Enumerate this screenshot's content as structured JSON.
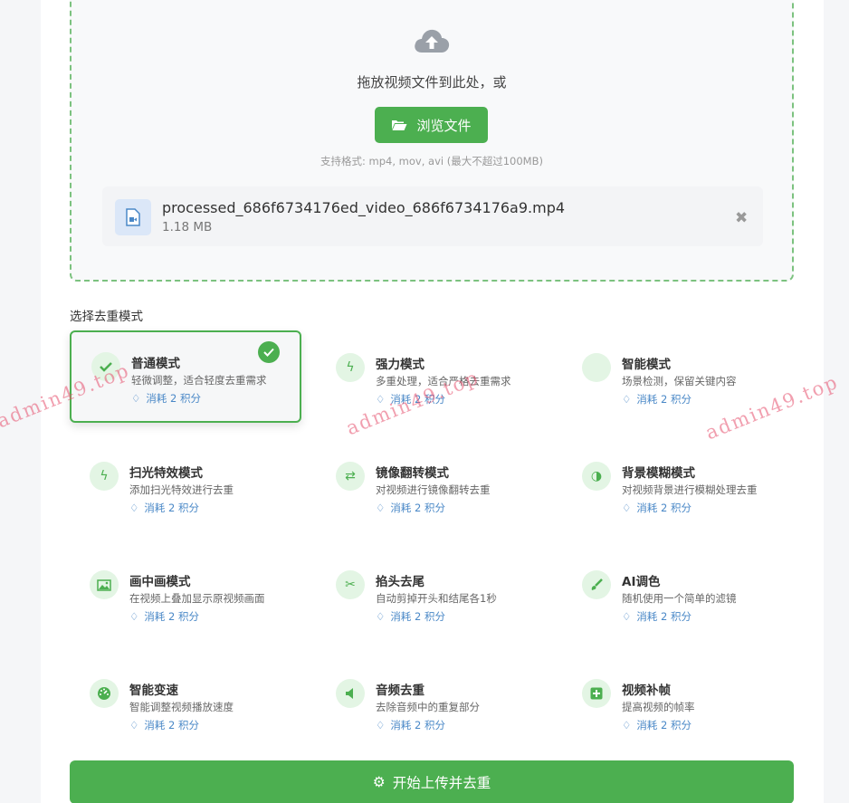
{
  "upload": {
    "drop_text": "拖放视频文件到此处，或",
    "browse_label": "浏览文件",
    "formats": "支持格式: mp4, mov, avi (最大不超过100MB)"
  },
  "file": {
    "name": "processed_686f6734176ed_video_686f6734176a9.mp4",
    "size": "1.18 MB"
  },
  "modes_title": "选择去重模式",
  "modes": [
    {
      "name": "普通模式",
      "desc": "轻微调整，适合轻度去重需求",
      "cost": "消耗 2 积分",
      "icon": "check-icon",
      "selected": true
    },
    {
      "name": "强力模式",
      "desc": "多重处理，适合严格去重需求",
      "cost": "消耗 2 积分",
      "icon": "bolt-icon"
    },
    {
      "name": "智能模式",
      "desc": "场景检测，保留关键内容",
      "cost": "消耗 2 积分",
      "icon": "blank-icon"
    },
    {
      "name": "扫光特效模式",
      "desc": "添加扫光特效进行去重",
      "cost": "消耗 2 积分",
      "icon": "bolt-icon"
    },
    {
      "name": "镜像翻转模式",
      "desc": "对视频进行镜像翻转去重",
      "cost": "消耗 2 积分",
      "icon": "swap-icon"
    },
    {
      "name": "背景模糊模式",
      "desc": "对视频背景进行模糊处理去重",
      "cost": "消耗 2 积分",
      "icon": "half-circle-icon"
    },
    {
      "name": "画中画模式",
      "desc": "在视频上叠加显示原视频画面",
      "cost": "消耗 2 积分",
      "icon": "image-icon"
    },
    {
      "name": "掐头去尾",
      "desc": "自动剪掉开头和结尾各1秒",
      "cost": "消耗 2 积分",
      "icon": "scissors-icon"
    },
    {
      "name": "AI调色",
      "desc": "随机使用一个简单的滤镜",
      "cost": "消耗 2 积分",
      "icon": "brush-icon"
    },
    {
      "name": "智能变速",
      "desc": "智能调整视频播放速度",
      "cost": "消耗 2 积分",
      "icon": "gauge-icon"
    },
    {
      "name": "音频去重",
      "desc": "去除音频中的重复部分",
      "cost": "消耗 2 积分",
      "icon": "volume-icon"
    },
    {
      "name": "视频补帧",
      "desc": "提高视频的帧率",
      "cost": "消耗 2 积分",
      "icon": "plus-square-icon"
    }
  ],
  "submit_label": "开始上传并去重",
  "watermark": "admin49.top",
  "colors": {
    "accent": "#4caf50",
    "cost": "#4a88c7",
    "border_dashed": "#7cc27f"
  }
}
